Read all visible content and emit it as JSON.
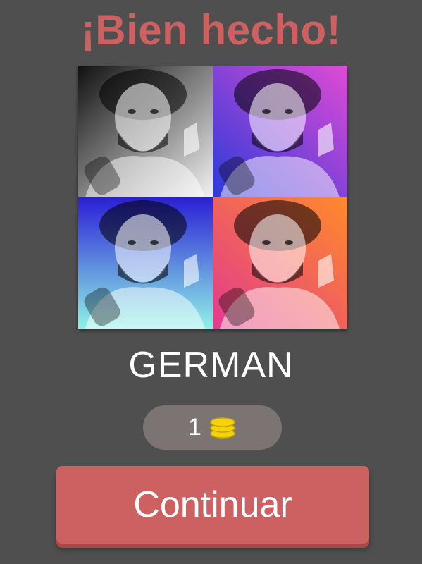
{
  "header": {
    "title": "¡Bien hecho!"
  },
  "puzzle": {
    "image_description": "four-panel pop-art portrait",
    "panels": [
      {
        "tint": "grayscale",
        "color_a": "#111111",
        "color_b": "#f2f2f2"
      },
      {
        "tint": "blue-purple",
        "color_a": "#2b3bd9",
        "color_b": "#e04ad6"
      },
      {
        "tint": "indigo-cyan",
        "color_a": "#2a1fd6",
        "color_b": "#8ff2e6"
      },
      {
        "tint": "orange-pink",
        "color_a": "#ff8a2a",
        "color_b": "#e23a8e"
      }
    ]
  },
  "answer": {
    "word": "GERMAN"
  },
  "reward": {
    "amount": "1",
    "icon": "coins-icon",
    "coin_color": "#f5d20a"
  },
  "actions": {
    "continue_label": "Continuar"
  },
  "colors": {
    "accent": "#cd6161",
    "background": "#4f4f4f",
    "pill": "#7b7472"
  }
}
